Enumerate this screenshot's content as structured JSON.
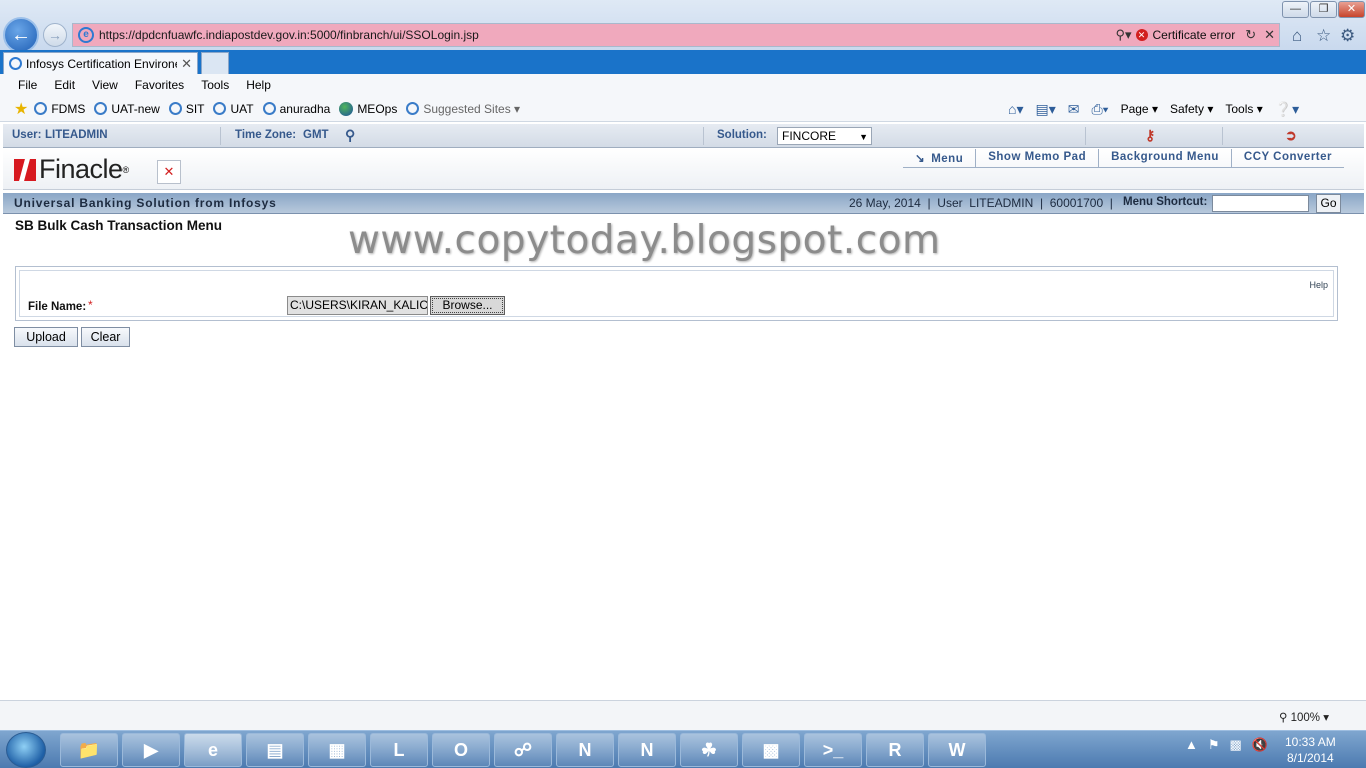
{
  "browser": {
    "url": "https://dpdcnfuawfc.indiapostdev.gov.in:5000/finbranch/ui/SSOLogin.jsp",
    "certificate_status": "Certificate error",
    "tab_title": "Infosys Certification Environe...",
    "menu": [
      "File",
      "Edit",
      "View",
      "Favorites",
      "Tools",
      "Help"
    ],
    "favorites": [
      "FDMS",
      "UAT-new",
      "SIT",
      "UAT",
      "anuradha",
      "MEOps",
      "Suggested Sites ▾"
    ],
    "command_bar": [
      "Page ▾",
      "Safety ▾",
      "Tools ▾"
    ],
    "zoom": "100%"
  },
  "app": {
    "user_label": "User:",
    "user": "LITEADMIN",
    "timezone_label": "Time Zone:",
    "timezone": "GMT",
    "solution_label": "Solution:",
    "solution_value": "FINCORE",
    "logo_text": "Finacle",
    "header_menu": [
      "Menu",
      "Show Memo Pad",
      "Background Menu",
      "CCY Converter"
    ],
    "banner_title": "Universal Banking Solution from Infosys",
    "banner_info": "26 May, 2014  |  User  LITEADMIN  |  60001700  |",
    "menu_shortcut_label": "Menu Shortcut:",
    "menu_shortcut_value": "",
    "go_label": "Go",
    "page_title": "SB Bulk Cash Transaction Menu",
    "watermark": "www.copytoday.blogspot.com",
    "help_label": "Help",
    "file_name_label": "File Name:",
    "required_mark": "*",
    "file_path": "C:\\USERS\\KIRAN_KALIC",
    "browse_label": "Browse...",
    "upload_label": "Upload",
    "clear_label": "Clear"
  },
  "taskbar": {
    "time": "10:33 AM",
    "date": "8/1/2014"
  },
  "colors": {
    "finacle_red": "#d71920",
    "app_blue_text": "#36598c",
    "address_error_pink": "#f0a9bd"
  }
}
